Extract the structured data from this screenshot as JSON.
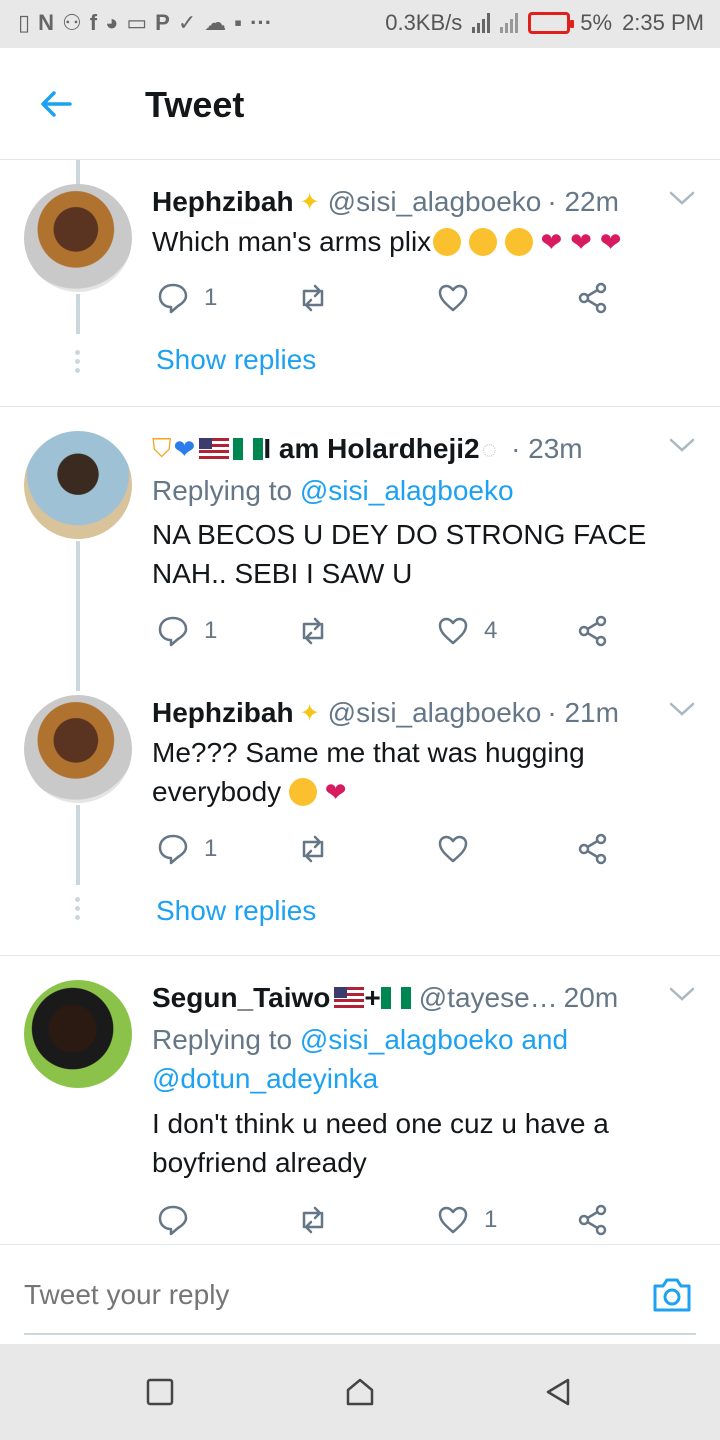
{
  "status_bar": {
    "left_icons": [
      "sim-icon",
      "n-icon",
      "person-add-icon",
      "facebook-icon",
      "messenger-icon",
      "message-icon",
      "p-icon",
      "check-icon",
      "cloud-icon",
      "voicemail-icon",
      "more-icon"
    ],
    "speed": "0.3KB/s",
    "battery": "5%",
    "time": "2:35 PM"
  },
  "header": {
    "title": "Tweet"
  },
  "tweets": [
    {
      "name": "Hephzibah",
      "handle": "@sisi_alagboeko",
      "time": "· 22m",
      "text": "Which man's arms plix",
      "replies": "1",
      "retweets": "",
      "likes": "",
      "show_replies": "Show replies"
    },
    {
      "name": "I am Holardheji2",
      "handle": "",
      "time": "· 23m",
      "replying_prefix": "Replying to",
      "replying_to": "@sisi_alagboeko",
      "text": "NA BECOS U DEY DO STRONG FACE NAH.. SEBI I SAW U",
      "replies": "1",
      "retweets": "",
      "likes": "4"
    },
    {
      "name": "Hephzibah",
      "handle": "@sisi_alagboeko",
      "time": "· 21m",
      "text": "Me??? Same me that was hugging everybody",
      "replies": "1",
      "retweets": "",
      "likes": "",
      "show_replies": "Show replies"
    },
    {
      "name": "Segun_Taiwo",
      "name_suffix": "+",
      "handle": "@tayese…",
      "time": "20m",
      "replying_prefix": "Replying to",
      "replying_to": "@sisi_alagboeko and @dotun_adeyinka",
      "text": "I don't think u need one cuz u have a boyfriend already",
      "replies": "",
      "retweets": "",
      "likes": "1"
    }
  ],
  "reply_box": {
    "placeholder": "Tweet your reply"
  },
  "colors": {
    "accent": "#1da1f2",
    "secondary_text": "#657786",
    "divider": "#e1e8ed"
  }
}
